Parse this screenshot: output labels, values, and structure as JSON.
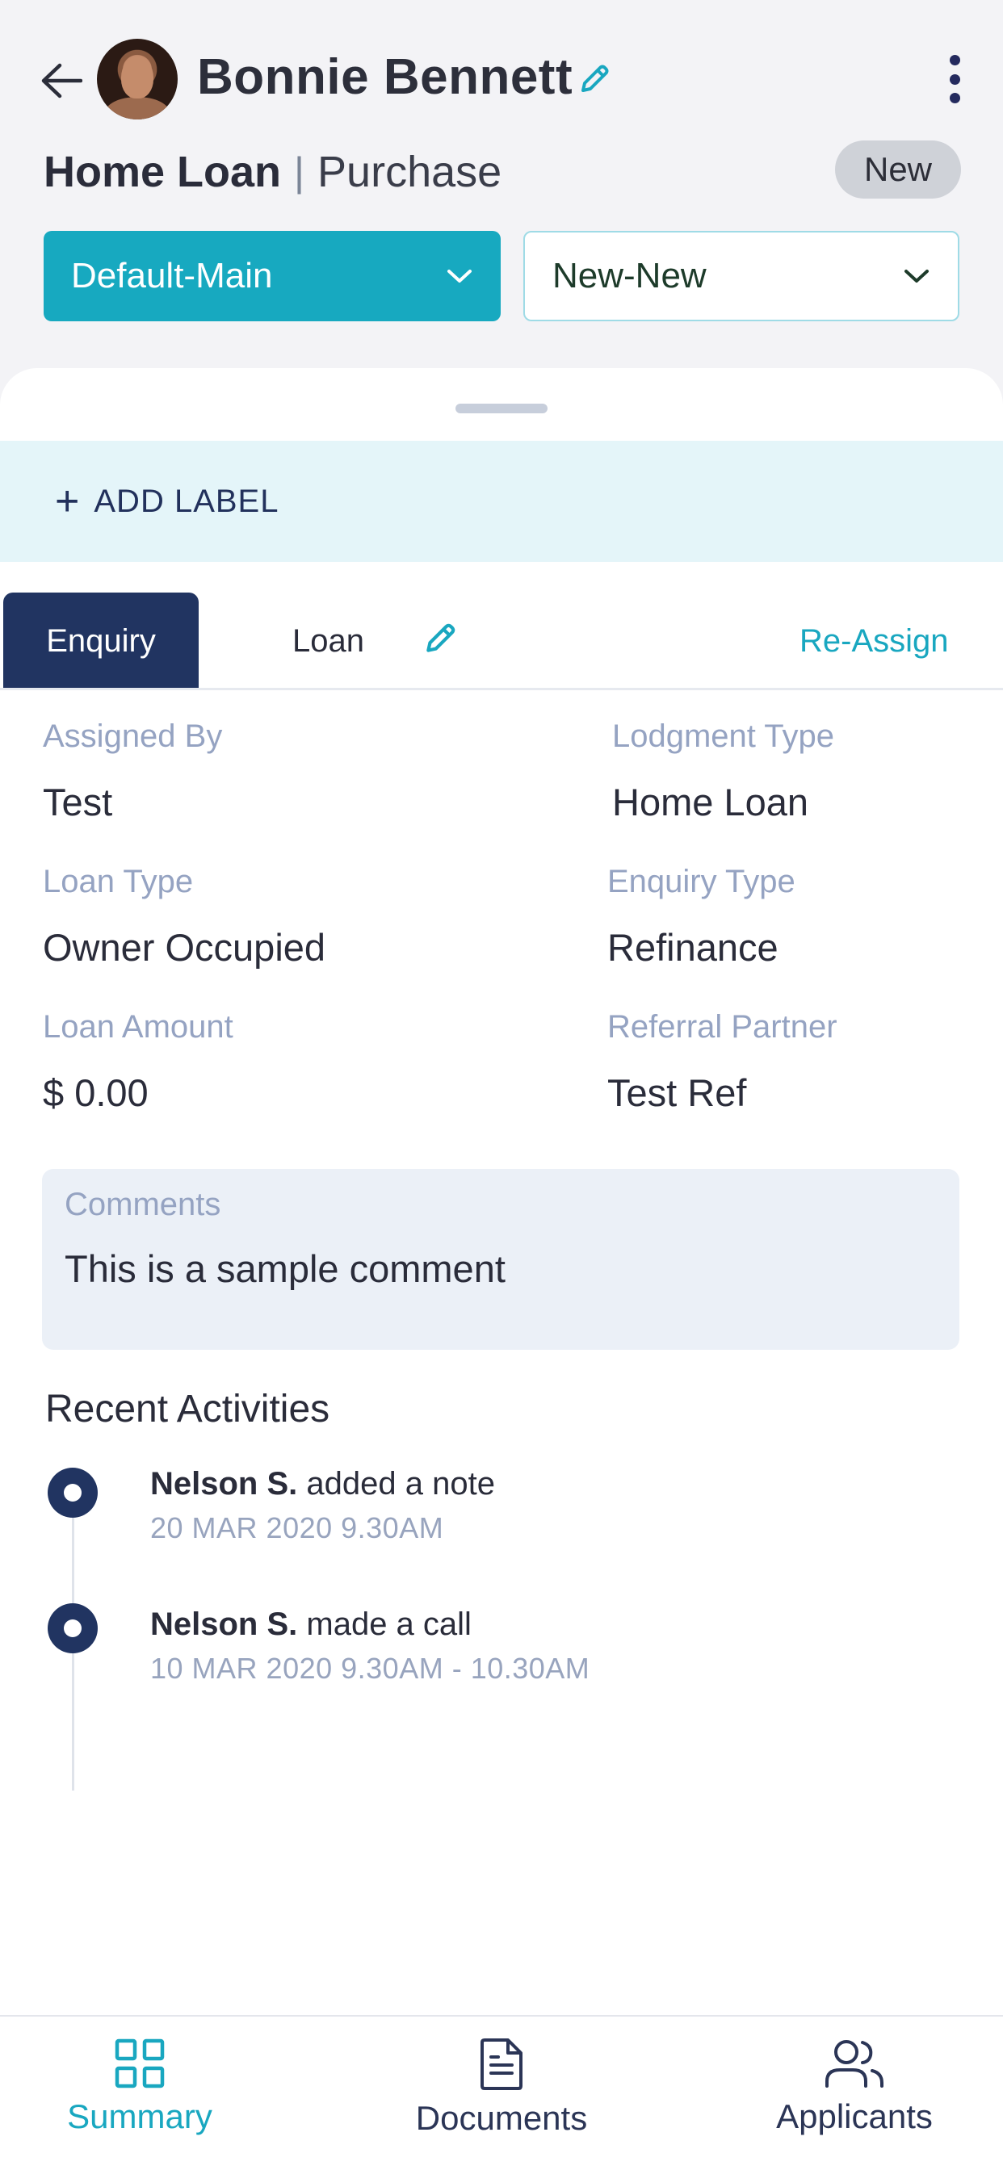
{
  "header": {
    "name": "Bonnie Bennett",
    "loan_type": "Home Loan",
    "separator": "|",
    "loan_purpose": "Purchase",
    "status_badge": "New",
    "dropdown_primary": "Default-Main",
    "dropdown_secondary": "New-New"
  },
  "label_bar": {
    "plus": "+",
    "label": "ADD LABEL"
  },
  "tabs": {
    "enquiry": "Enquiry",
    "loan": "Loan",
    "reassign": "Re-Assign"
  },
  "details": {
    "assigned_by": {
      "label": "Assigned By",
      "value": "Test"
    },
    "lodgment_type": {
      "label": "Lodgment Type",
      "value": "Home Loan"
    },
    "loan_type": {
      "label": "Loan Type",
      "value": "Owner Occupied"
    },
    "enquiry_type": {
      "label": "Enquiry Type",
      "value": "Refinance"
    },
    "loan_amount": {
      "label": "Loan Amount",
      "value": "$ 0.00"
    },
    "referral_partner": {
      "label": "Referral Partner",
      "value": "Test Ref"
    }
  },
  "comments": {
    "label": "Comments",
    "text": "This is a sample comment"
  },
  "recent": {
    "title": "Recent Activities",
    "items": [
      {
        "who": "Nelson S.",
        "action": " added a note",
        "when": "20 MAR 2020  9.30AM"
      },
      {
        "who": "Nelson S.",
        "action": " made a call",
        "when": "10 MAR 2020  9.30AM - 10.30AM"
      }
    ]
  },
  "bottom_nav": {
    "summary": "Summary",
    "documents": "Documents",
    "applicants": "Applicants"
  },
  "colors": {
    "accent": "#17a9c0",
    "navy": "#213461",
    "label_bar_bg": "#e4f5f9",
    "muted_label": "#95a3c2"
  }
}
